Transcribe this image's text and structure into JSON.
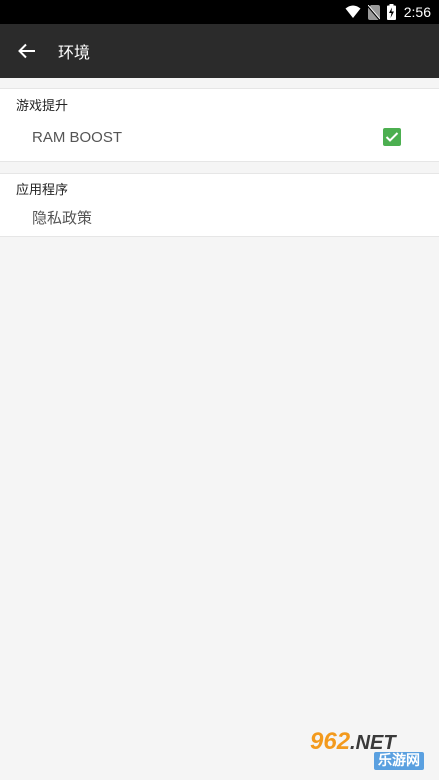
{
  "status_bar": {
    "time": "2:56",
    "icons": [
      "wifi-icon",
      "no-sim-icon",
      "battery-charging-icon"
    ]
  },
  "toolbar": {
    "title": "环境",
    "back_icon": "arrow-left-icon"
  },
  "sections": [
    {
      "header": "游戏提升",
      "items": [
        {
          "label": "RAM BOOST",
          "control": "checkbox",
          "checked": true
        }
      ]
    },
    {
      "header": "应用程序",
      "items": [
        {
          "label": "隐私政策"
        }
      ]
    }
  ],
  "watermark": {
    "top": "962.NET",
    "bottom": "乐游网"
  },
  "colors": {
    "toolbar_bg": "#2b2b2b",
    "status_bar_bg": "#000000",
    "checkbox_accent": "#4caf50",
    "page_bg": "#f5f5f5"
  }
}
